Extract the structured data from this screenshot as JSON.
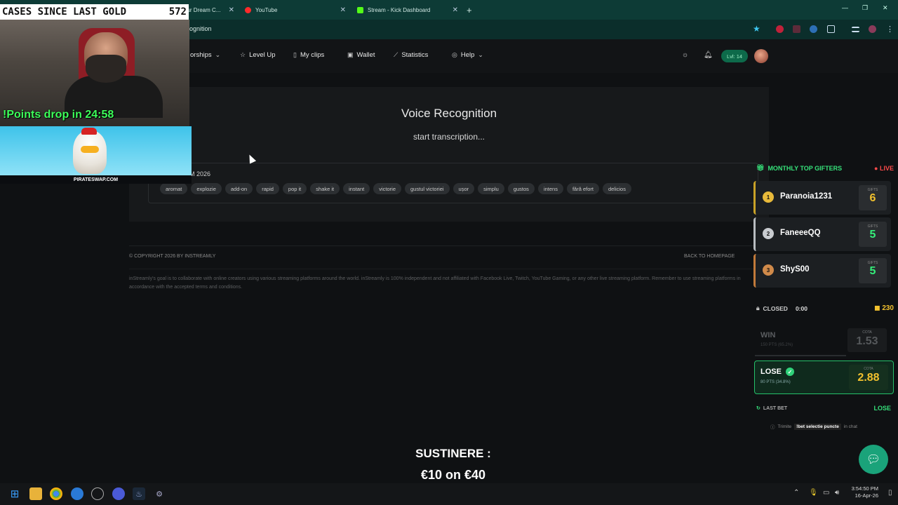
{
  "browser": {
    "tabs": [
      {
        "label": "our Dream C...",
        "icon": "kick-icon",
        "color": "#53fc18"
      },
      {
        "label": "YouTube",
        "icon": "youtube-icon",
        "color": "#ff0000"
      },
      {
        "label": "Stream - Kick Dashboard",
        "icon": "kick-icon",
        "color": "#53fc18"
      }
    ],
    "new_tab": "+",
    "address": "ognition",
    "window_controls": [
      "—",
      "❐",
      "✕"
    ]
  },
  "nav": {
    "sponsorships": "orships",
    "level_up": "Level Up",
    "my_clips": "My clips",
    "wallet": "Wallet",
    "statistics": "Statistics",
    "help": "Help",
    "level_badge": "Lvl: 14"
  },
  "main": {
    "title": "Voice Recognition",
    "subtitle": "start transcription...",
    "date_label": "M 2026",
    "tags": [
      "aromat",
      "explozie",
      "add-on",
      "rapid",
      "pop it",
      "shake it",
      "instant",
      "victorie",
      "gustul victoriei",
      "ușor",
      "simplu",
      "gustos",
      "intens",
      "fără efort",
      "delicios"
    ]
  },
  "footer": {
    "copyright": "© COPYRIGHT 2026 BY INSTREAMLY",
    "back_home": "BACK TO HOMEPAGE",
    "disclaimer": "inStreamly's goal is to collaborate with online creators using various streaming platforms around the world. inStreamly is 100% independent and not affiliated with Facebook Live, Twitch, YouTube Gaming, or any other live streaming platform. Remember to use streaming platforms in accordance with the accepted terms and conditions."
  },
  "overlay": {
    "cases_label": "CASES SINCE LAST GOLD",
    "cases_count": "572",
    "points_drop": "!Points drop in 24:58",
    "ad_brand": "PIRATESWAP.COM",
    "gifters_title": "MONTHLY TOP GIFTERS",
    "live": "LIVE",
    "gifts_label": "GIFTS",
    "gifters": [
      {
        "rank": "1",
        "name": "Paranoia1231",
        "gifts": "6",
        "color": "#c9a227"
      },
      {
        "rank": "2",
        "name": "FaneeeQQ",
        "gifts": "5",
        "color": "#b8bcc0"
      },
      {
        "rank": "3",
        "name": "ShyS00",
        "gifts": "5",
        "color": "#c27a3a"
      }
    ],
    "bet": {
      "status": "CLOSED",
      "timer": "0:00",
      "coins": "230",
      "cota_label": "COTA",
      "win": {
        "label": "WIN",
        "pts": "150 PTS (65.2%)",
        "cota": "1.53"
      },
      "lose": {
        "label": "LOSE",
        "pts": "80 PTS (34.8%)",
        "cota": "2.88"
      },
      "last_bet_label": "LAST BET",
      "last_bet_result": "LOSE",
      "hint_pre": "Trimite",
      "hint_cmd": "!bet selectie puncte",
      "hint_post": "in chat"
    },
    "sustinere": "SUSTINERE :",
    "sustinere_value": "€10 on €40"
  },
  "taskbar": {
    "time": "3:54:50 PM",
    "date": "16-Apr-26"
  }
}
